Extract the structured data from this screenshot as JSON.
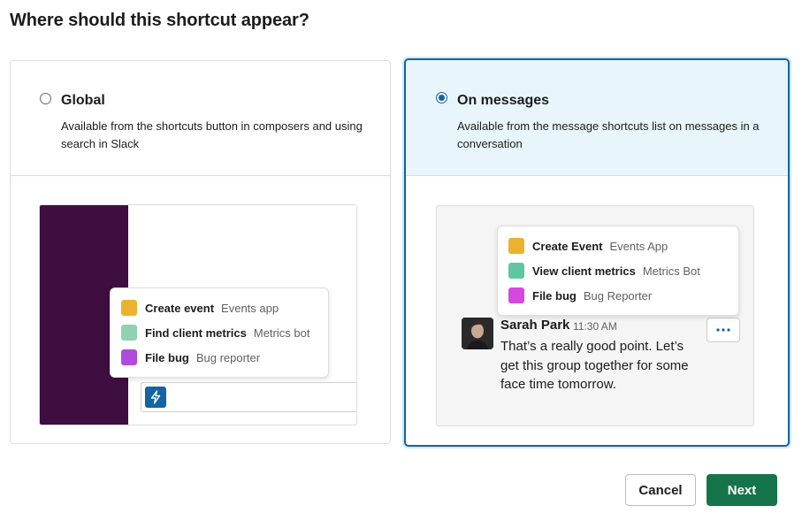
{
  "dialog": {
    "title": "Where should this shortcut appear?"
  },
  "options": {
    "global": {
      "title": "Global",
      "description": "Available from the shortcuts button in composers and using search in Slack",
      "selected": false,
      "menu": [
        {
          "name": "Create event",
          "app": "Events app",
          "color": "#ecb22e"
        },
        {
          "name": "Find client metrics",
          "app": "Metrics bot",
          "color": "#8fd1b0"
        },
        {
          "name": "File bug",
          "app": "Bug reporter",
          "color": "#b04bdc"
        }
      ]
    },
    "messages": {
      "title": "On messages",
      "description": "Available from the message shortcuts list on messages in a conversation",
      "selected": true,
      "menu": [
        {
          "name": "Create Event",
          "app": "Events App",
          "color": "#ecb22e"
        },
        {
          "name": "View client metrics",
          "app": "Metrics Bot",
          "color": "#5ec7a1"
        },
        {
          "name": "File bug",
          "app": "Bug Reporter",
          "color": "#d648e0"
        }
      ],
      "message": {
        "author": "Sarah Park",
        "time": "11:30 AM",
        "text": "That’s a really good point. Let’s get this group together for some face time tomorrow."
      }
    }
  },
  "footer": {
    "cancel_label": "Cancel",
    "next_label": "Next"
  },
  "colors": {
    "accent": "#1264a3",
    "sidebar": "#3f0e40",
    "primary_button": "#157449",
    "selected_bg": "#e8f5fa"
  },
  "icons": {
    "composer": "lightning-bolt-icon",
    "more": "more-actions-icon"
  }
}
